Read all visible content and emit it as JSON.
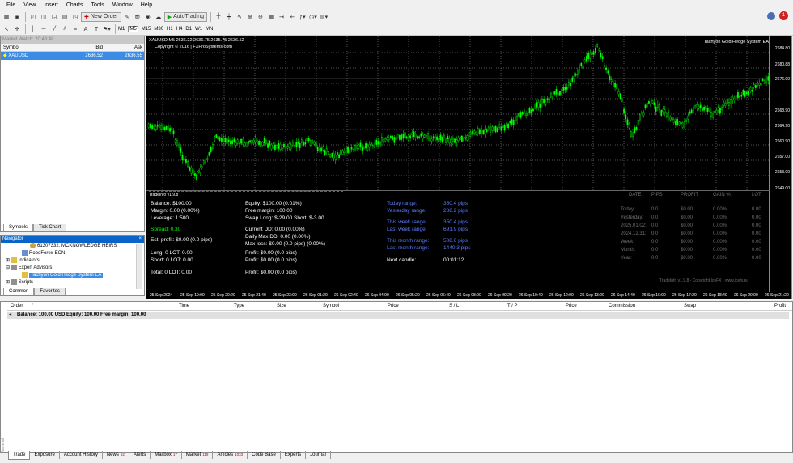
{
  "menu": [
    "File",
    "View",
    "Insert",
    "Charts",
    "Tools",
    "Window",
    "Help"
  ],
  "toolbar": {
    "new_order": "New Order",
    "autotrading": "AutoTrading",
    "timeframes": [
      "M1",
      "M5",
      "M15",
      "M30",
      "H1",
      "H4",
      "D1",
      "W1",
      "MN"
    ],
    "notif_count": "1"
  },
  "market_watch": {
    "title": "Market Watch: 20:48:48",
    "headers": {
      "symbol": "Symbol",
      "bid": "Bid",
      "ask": "Ask"
    },
    "rows": [
      {
        "symbol": "XAUUSD",
        "bid": "2636.52",
        "ask": "2636.55"
      }
    ],
    "tabs": [
      "Symbols",
      "Tick Chart"
    ]
  },
  "navigator": {
    "title": "Navigator",
    "items": [
      "61307332: MCKNOWLEDGE HEIRS",
      "RoboForex-ECN",
      "Indicators",
      "Expert Advisors",
      "Tachyon Gold Hedge System EA",
      "Scripts"
    ],
    "tabs": [
      "Common",
      "Favorites"
    ]
  },
  "chart": {
    "title": "XAUUSD,M5  2636.22 2636.75 2635.75 2636.52",
    "copyright": "Copyright © 2016 | FXProSystems.com",
    "ea": "Tachyon Gold Hedge System EA",
    "prices": [
      "2684.80",
      "2680.88",
      "2676.90",
      "2668.90",
      "2664.90",
      "2660.90",
      "2657.00",
      "2653.00",
      "2649.00"
    ],
    "times": [
      "25 Sep 2024",
      "25 Sep 19:00",
      "25 Sep 20:20",
      "25 Sep 21:40",
      "25 Sep 23:00",
      "26 Sep 01:20",
      "26 Sep 02:40",
      "26 Sep 04:00",
      "26 Sep 05:20",
      "26 Sep 06:40",
      "26 Sep 08:00",
      "26 Sep 09:20",
      "26 Sep 10:40",
      "26 Sep 12:00",
      "26 Sep 13:20",
      "26 Sep 14:40",
      "26 Sep 16:00",
      "26 Sep 17:20",
      "26 Sep 18:40",
      "26 Sep 20:00",
      "26 Sep 21:20"
    ]
  },
  "tradeinfo": {
    "name": "TradeInfo v1.9.8",
    "c1": [
      "Balance: $100.00",
      "Margin: 0.00  (0.00%)",
      "Leverage: 1:500",
      "Spread: 0.30",
      "Est. profit: $0.00  (0.0 pips)",
      "Long:  0    LOT: 0.00",
      "Short:  0    LOT: 0.00",
      "Total:  0    LOT: 0.00"
    ],
    "c2": [
      "Equity: $100.00  (0.01%)",
      "Free margin: 100.00",
      "Swap  Long: $-29.00  Short: $-3.00",
      "Current   DD: 0.00  (0.00%)",
      "Daily Max DD: 0.00   (0.00%)",
      "Max loss: $0.00  (0.0 pips)  (0.00%)",
      "Profit:  $0.00  (0.0 pips)",
      "Profit:  $0.00  (0.0 pips)",
      "Profit:  $0.00  (0.0 pips)"
    ],
    "ranges": [
      {
        "label": "Today range:",
        "value": "350.4 pips"
      },
      {
        "label": "Yesterday range:",
        "value": "288.2 pips"
      },
      {
        "label": "This week range:",
        "value": "350.4 pips"
      },
      {
        "label": "Last week range:",
        "value": "691.9 pips"
      },
      {
        "label": "This month range:",
        "value": "508.6 pips"
      },
      {
        "label": "Last month range:",
        "value": "1440.3 pips"
      },
      {
        "label": "Next candle:",
        "value": "00:01:12"
      }
    ],
    "grid_headers": [
      "DATE",
      "PIPS",
      "PROFIT",
      "GAIN %",
      "LOT"
    ],
    "grid_rows": [
      [
        "Today:",
        "0.0",
        "$0.00",
        "0.00%",
        "0.00"
      ],
      [
        "Yesterday:",
        "0.0",
        "$0.00",
        "0.00%",
        "0.00"
      ],
      [
        "2025.01.02:",
        "0.0",
        "$0.00",
        "0.00%",
        "0.00"
      ],
      [
        "2024.12.31:",
        "0.0",
        "$0.00",
        "0.00%",
        "0.00"
      ],
      [
        "Week:",
        "0.0",
        "$0.00",
        "0.00%",
        "0.00"
      ],
      [
        "Month:",
        "0.0",
        "$0.00",
        "0.00%",
        "0.00"
      ],
      [
        "Year:",
        "0.0",
        "$0.00",
        "0.00%",
        "0.00"
      ]
    ],
    "footer": "TradeInfo v1.9.8 - Copyright IceFX - www.icefx.eu"
  },
  "terminal": {
    "headers": [
      "Order",
      "/",
      "Time",
      "Type",
      "Size",
      "Symbol",
      "Price",
      "S / L",
      "T / P",
      "Price",
      "Commission",
      "Swap",
      "Profit"
    ],
    "balance": "Balance: 100.00 USD  Equity: 100.00  Free margin: 100.00",
    "side_label": "Terminal"
  },
  "bottom_tabs": [
    {
      "label": "Trade",
      "count": ""
    },
    {
      "label": "Exposure",
      "count": ""
    },
    {
      "label": "Account History",
      "count": ""
    },
    {
      "label": "News",
      "count": "62"
    },
    {
      "label": "Alerts",
      "count": ""
    },
    {
      "label": "Mailbox",
      "count": "17"
    },
    {
      "label": "Market",
      "count": "119"
    },
    {
      "label": "Articles",
      "count": "1033"
    },
    {
      "label": "Code Base",
      "count": ""
    },
    {
      "label": "Experts",
      "count": ""
    },
    {
      "label": "Journal",
      "count": ""
    }
  ]
}
